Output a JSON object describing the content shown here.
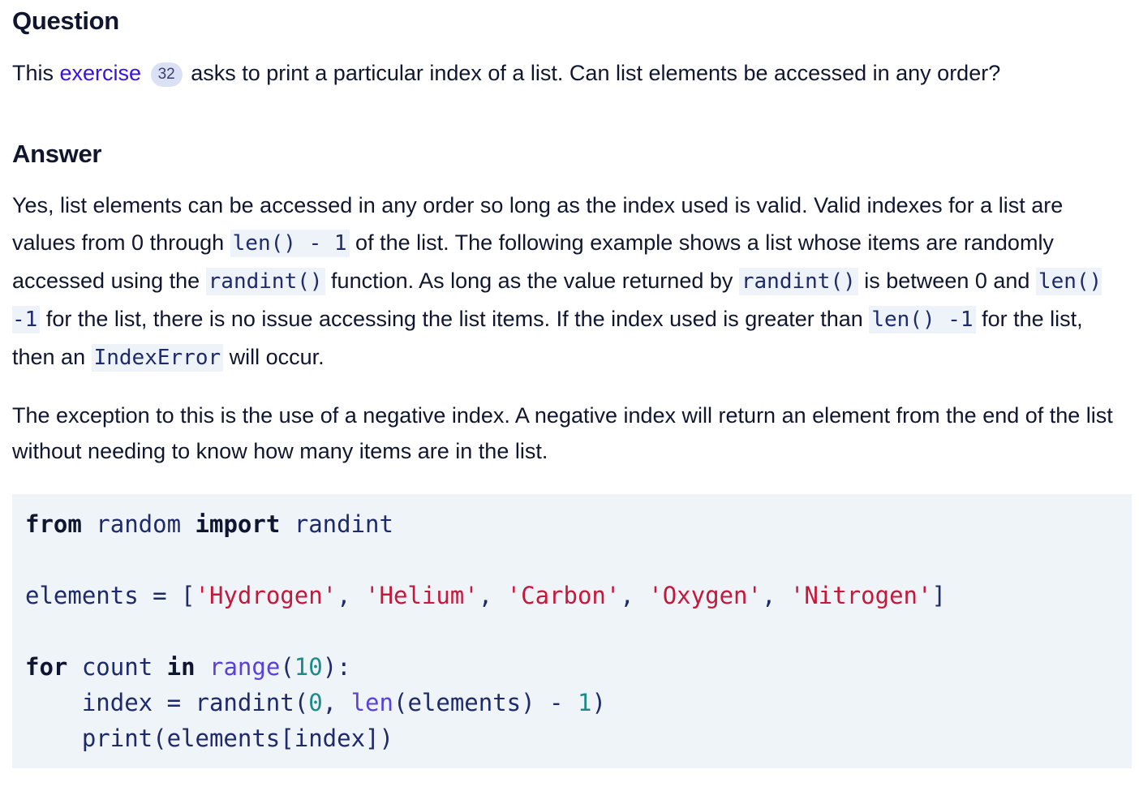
{
  "question": {
    "heading": "Question",
    "text_before": "This ",
    "link": "exercise",
    "badge": "32",
    "text_after": " asks to print a particular index of a list. Can list elements be accessed in any order?"
  },
  "answer": {
    "heading": "Answer",
    "p1": {
      "t1": "Yes, list elements can be accessed in any order so long as the index used is valid. Valid indexes for a list are values from 0 through ",
      "c1": "len() - 1",
      "t2": " of the list. The following example shows a list whose items are randomly accessed using the ",
      "c2": "randint()",
      "t3": " function. As long as the value returned by ",
      "c3": "randint()",
      "t4": " is between 0 and ",
      "c4": "len() -1",
      "t5": " for the list, there is no issue accessing the list items. If the index used is greater than ",
      "c5": "len() -1",
      "t6": " for the list, then an ",
      "c6": "IndexError",
      "t7": " will occur."
    },
    "p2": "The exception to this is the use of a negative index. A negative index will return an element from the end of the list without needing to know how many items are in the list."
  },
  "code": {
    "l1": {
      "kw1": "from",
      "t1": " random ",
      "kw2": "import",
      "t2": " randint"
    },
    "l2": {
      "t1": "elements = [",
      "s1": "'Hydrogen'",
      "c1": ", ",
      "s2": "'Helium'",
      "c2": ", ",
      "s3": "'Carbon'",
      "c3": ", ",
      "s4": "'Oxygen'",
      "c4": ", ",
      "s5": "'Nitrogen'",
      "t2": "]"
    },
    "l3": {
      "kw1": "for",
      "t1": " count ",
      "kw2": "in",
      "t2": " ",
      "b1": "range",
      "t3": "(",
      "n1": "10",
      "t4": "):"
    },
    "l4": {
      "t1": "    index = randint(",
      "n1": "0",
      "t2": ", ",
      "b1": "len",
      "t3": "(elements) - ",
      "n2": "1",
      "t4": ")"
    },
    "l5": {
      "t1": "    print(elements[index])"
    }
  }
}
